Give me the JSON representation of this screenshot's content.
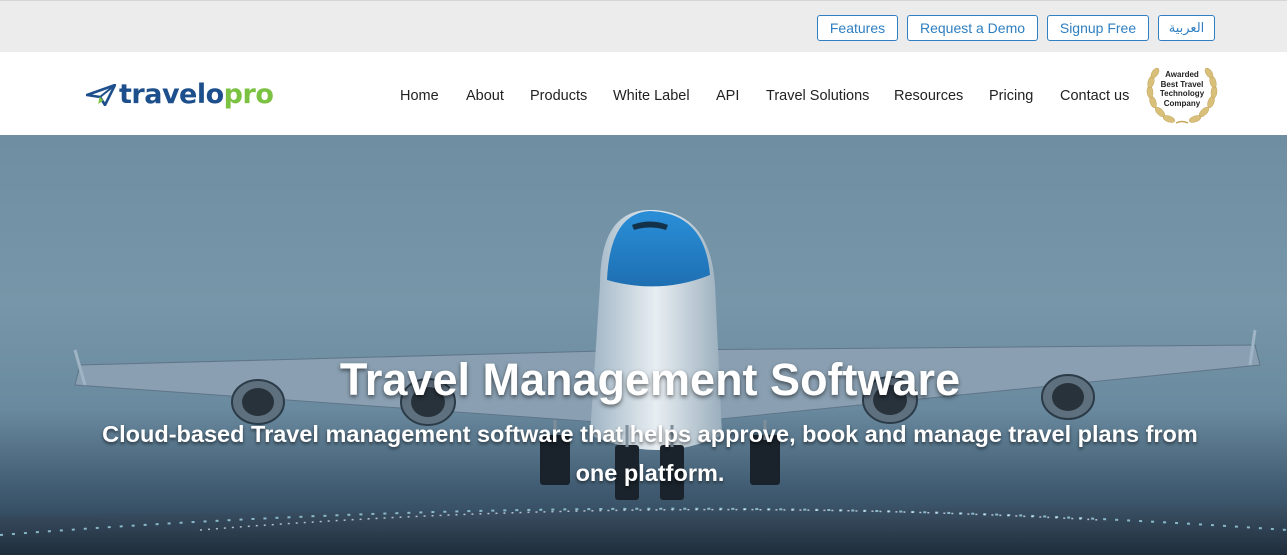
{
  "topbar": {
    "features": "Features",
    "request_demo": "Request a Demo",
    "signup": "Signup Free",
    "arabic": "العربية"
  },
  "brand": {
    "name_part1": "travelo",
    "name_part2": "pro",
    "primary_color": "#1d4f8c",
    "accent_color": "#7cc242"
  },
  "nav": {
    "items": [
      {
        "label": "Home"
      },
      {
        "label": "About"
      },
      {
        "label": "Products"
      },
      {
        "label": "White Label"
      },
      {
        "label": "API"
      },
      {
        "label": "Travel Solutions"
      },
      {
        "label": "Resources"
      },
      {
        "label": "Pricing"
      },
      {
        "label": "Contact us"
      }
    ]
  },
  "badge": {
    "line1": "Awarded",
    "line2": "Best Travel",
    "line3": "Technology",
    "line4": "Company"
  },
  "hero": {
    "title": "Travel Management Software",
    "subtitle": "Cloud-based Travel management software that helps approve, book and manage travel plans from one platform."
  },
  "colors": {
    "link_blue": "#2f7fc1",
    "topbar_bg": "#ececec"
  }
}
